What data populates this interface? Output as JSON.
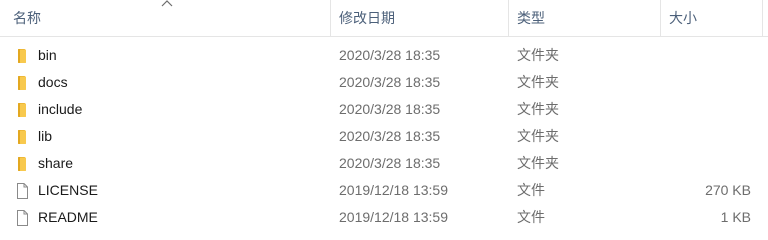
{
  "columns": {
    "name": "名称",
    "modified": "修改日期",
    "type": "类型",
    "size": "大小"
  },
  "colors": {
    "header_text": "#4c607a",
    "folder": "#f8c94e",
    "folder_dark": "#e3a820",
    "secondary_text": "#6d6d6d"
  },
  "rows": [
    {
      "icon": "folder-icon",
      "name": "bin",
      "modified": "2020/3/28 18:35",
      "type": "文件夹",
      "size": ""
    },
    {
      "icon": "folder-icon",
      "name": "docs",
      "modified": "2020/3/28 18:35",
      "type": "文件夹",
      "size": ""
    },
    {
      "icon": "folder-icon",
      "name": "include",
      "modified": "2020/3/28 18:35",
      "type": "文件夹",
      "size": ""
    },
    {
      "icon": "folder-icon",
      "name": "lib",
      "modified": "2020/3/28 18:35",
      "type": "文件夹",
      "size": ""
    },
    {
      "icon": "folder-icon",
      "name": "share",
      "modified": "2020/3/28 18:35",
      "type": "文件夹",
      "size": ""
    },
    {
      "icon": "file-icon",
      "name": "LICENSE",
      "modified": "2019/12/18 13:59",
      "type": "文件",
      "size": "270 KB"
    },
    {
      "icon": "file-icon",
      "name": "README",
      "modified": "2019/12/18 13:59",
      "type": "文件",
      "size": "1 KB"
    }
  ]
}
